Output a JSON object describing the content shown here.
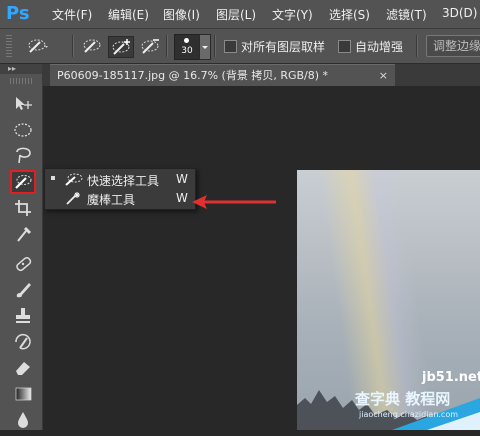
{
  "app": {
    "logo": "Ps"
  },
  "menu": [
    "文件(F)",
    "编辑(E)",
    "图像(I)",
    "图层(L)",
    "文字(Y)",
    "选择(S)",
    "滤镜(T)",
    "3D(D)"
  ],
  "options": {
    "brush_size": "30",
    "sample_all_layers": "对所有图层取样",
    "auto_enhance": "自动增强",
    "refine_edge": "调整边缘"
  },
  "document": {
    "tab_title": "P60609-185117.jpg @ 16.7% (背景 拷贝, RGB/8) *",
    "close": "×"
  },
  "toolbar": {
    "collapse": "▸▸"
  },
  "flyout": {
    "items": [
      {
        "label": "快速选择工具",
        "shortcut": "W",
        "icon": "quick-selection-icon",
        "selected": true
      },
      {
        "label": "魔棒工具",
        "shortcut": "W",
        "icon": "magic-wand-icon",
        "selected": false
      }
    ]
  },
  "annotation": {
    "arrow_color": "#e03030",
    "highlight_color": "#e02020"
  },
  "watermark": {
    "line1": "查字典 教程网",
    "line2": "jb51.net",
    "line3": "jiaocheng.chazidian.com"
  }
}
